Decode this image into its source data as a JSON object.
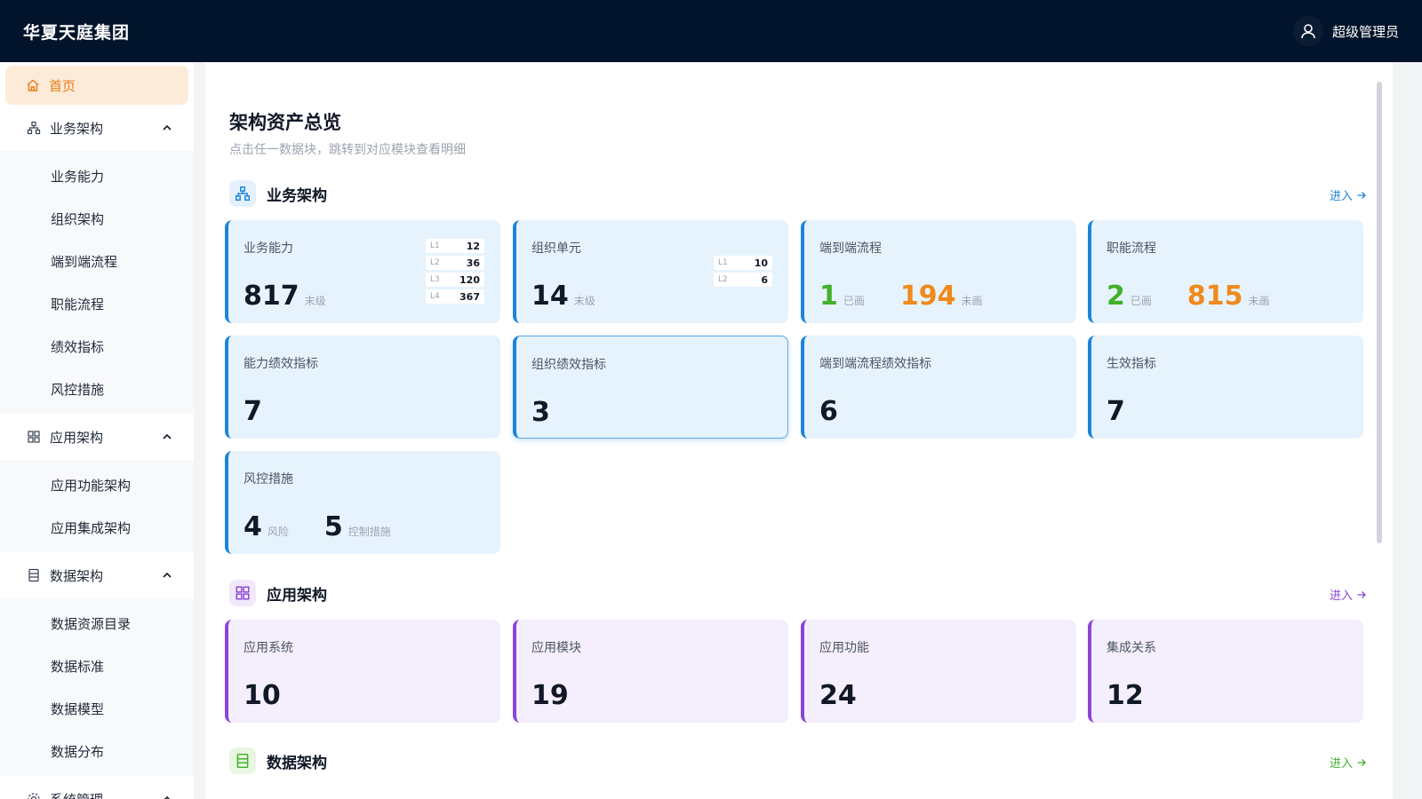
{
  "header": {
    "brand": "华夏天庭集团",
    "user": "超级管理员"
  },
  "sidebar": {
    "home": "首页",
    "groups": [
      {
        "label": "业务架构",
        "items": [
          "业务能力",
          "组织架构",
          "端到端流程",
          "职能流程",
          "绩效指标",
          "风控措施"
        ]
      },
      {
        "label": "应用架构",
        "items": [
          "应用功能架构",
          "应用集成架构"
        ]
      },
      {
        "label": "数据架构",
        "items": [
          "数据资源目录",
          "数据标准",
          "数据模型",
          "数据分布"
        ]
      },
      {
        "label": "系统管理",
        "items": []
      }
    ]
  },
  "main": {
    "title": "架构资产总览",
    "subtitle": "点击任一数据块，跳转到对应模块查看明细",
    "enter_label": "进入",
    "sections": {
      "biz": {
        "title": "业务架构",
        "cards": {
          "capability": {
            "label": "业务能力",
            "value": "817",
            "unit": "末级",
            "levels": [
              {
                "k": "L1",
                "v": "12"
              },
              {
                "k": "L2",
                "v": "36"
              },
              {
                "k": "L3",
                "v": "120"
              },
              {
                "k": "L4",
                "v": "367"
              }
            ]
          },
          "org_unit": {
            "label": "组织单元",
            "value": "14",
            "unit": "末级",
            "levels": [
              {
                "k": "L1",
                "v": "10"
              },
              {
                "k": "L2",
                "v": "6"
              }
            ]
          },
          "e2e": {
            "label": "端到端流程",
            "drawn": "1",
            "drawn_unit": "已画",
            "undrawn": "194",
            "undrawn_unit": "未画"
          },
          "func": {
            "label": "职能流程",
            "drawn": "2",
            "drawn_unit": "已画",
            "undrawn": "815",
            "undrawn_unit": "未画"
          },
          "cap_kpi": {
            "label": "能力绩效指标",
            "value": "7"
          },
          "org_kpi": {
            "label": "组织绩效指标",
            "value": "3"
          },
          "e2e_kpi": {
            "label": "端到端流程绩效指标",
            "value": "6"
          },
          "active_kpi": {
            "label": "生效指标",
            "value": "7"
          },
          "risk": {
            "label": "风控措施",
            "risk": "4",
            "risk_unit": "风险",
            "ctrl": "5",
            "ctrl_unit": "控制措施"
          }
        }
      },
      "app": {
        "title": "应用架构",
        "cards": {
          "system": {
            "label": "应用系统",
            "value": "10"
          },
          "module": {
            "label": "应用模块",
            "value": "19"
          },
          "function": {
            "label": "应用功能",
            "value": "24"
          },
          "integration": {
            "label": "集成关系",
            "value": "12"
          }
        }
      },
      "data": {
        "title": "数据架构"
      }
    }
  },
  "colors": {
    "header_bg": "#02142b",
    "accent_orange": "#ea7a13",
    "biz_blue": "#1c84d9",
    "app_purple": "#8b45d6",
    "data_green": "#43b02a"
  },
  "icons": {
    "home": "home-icon",
    "user": "user-icon",
    "biz": "org-tree-icon",
    "app": "grid-icon",
    "data": "database-icon",
    "sys": "gear-icon"
  }
}
